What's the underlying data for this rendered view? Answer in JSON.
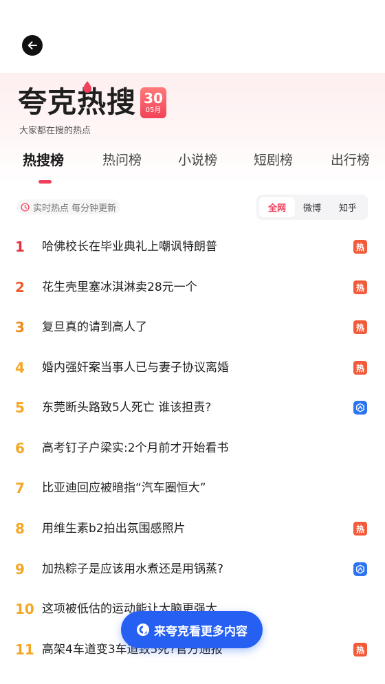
{
  "header": {
    "back_label": "返回"
  },
  "brand": {
    "title": "夸克热搜",
    "day": "30",
    "month": "05月",
    "subtitle": "大家都在搜的热点"
  },
  "tabs": [
    {
      "label": "热搜榜",
      "active": true
    },
    {
      "label": "热问榜",
      "active": false
    },
    {
      "label": "小说榜",
      "active": false
    },
    {
      "label": "短剧榜",
      "active": false
    },
    {
      "label": "出行榜",
      "active": false
    }
  ],
  "filter": {
    "realtime_label": "实时热点 每分钟更新",
    "segments": [
      {
        "label": "全网",
        "active": true
      },
      {
        "label": "微博",
        "active": false
      },
      {
        "label": "知乎",
        "active": false
      }
    ]
  },
  "list": [
    {
      "rank": "1",
      "title": "哈佛校长在毕业典礼上嘲讽特朗普",
      "badge": "hot",
      "rank_color": "#e8313f"
    },
    {
      "rank": "2",
      "title": "花生壳里塞冰淇淋卖28元一个",
      "badge": "hot",
      "rank_color": "#f25a2a"
    },
    {
      "rank": "3",
      "title": "复旦真的请到高人了",
      "badge": "hot",
      "rank_color": "#f28a1a"
    },
    {
      "rank": "4",
      "title": "婚内强奸案当事人已与妻子协议离婚",
      "badge": "hot",
      "rank_color": "#f5a623"
    },
    {
      "rank": "5",
      "title": "东莞断头路致5人死亡 谁该担责?",
      "badge": "ai",
      "rank_color": "#f5a623"
    },
    {
      "rank": "6",
      "title": "高考钉子户梁实:2个月前才开始看书",
      "badge": "",
      "rank_color": "#f5a623"
    },
    {
      "rank": "7",
      "title": "比亚迪回应被暗指“汽车圈恒大”",
      "badge": "",
      "rank_color": "#f5a623"
    },
    {
      "rank": "8",
      "title": "用维生素b2拍出氛围感照片",
      "badge": "hot",
      "rank_color": "#f5a623"
    },
    {
      "rank": "9",
      "title": "加热粽子是应该用水煮还是用锅蒸?",
      "badge": "ai",
      "rank_color": "#f5a623"
    },
    {
      "rank": "10",
      "title": "这项被低估的运动能让大脑更强大",
      "badge": "",
      "rank_color": "#f5a623"
    },
    {
      "rank": "11",
      "title": "高架4车道变3车道致5死?官方通报",
      "badge": "hot",
      "rank_color": "#f5a623"
    }
  ],
  "hot_badge_text": "热",
  "floating_cta": {
    "label": "来夸克看更多内容"
  },
  "colors": {
    "accent": "#f0405b",
    "cta": "#2560f2",
    "hot_badge": "#f25a3a",
    "ai_badge": "#2b73f0"
  }
}
